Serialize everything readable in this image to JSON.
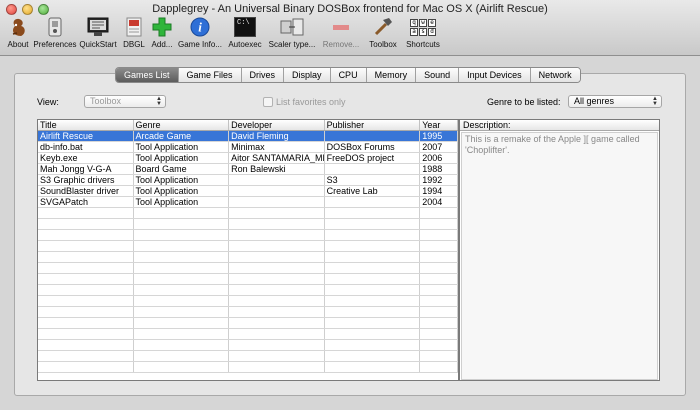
{
  "window": {
    "title": "Dapplegrey - An Universal Binary DOSBox frontend for Mac OS X (Airlift Rescue)"
  },
  "toolbar": [
    {
      "label": "About",
      "icon": "squirrel-icon",
      "enabled": true
    },
    {
      "label": "Preferences",
      "icon": "preferences-icon",
      "enabled": true
    },
    {
      "label": "QuickStart",
      "icon": "monitor-icon",
      "enabled": true
    },
    {
      "label": "DBGL",
      "icon": "dbgl-icon",
      "enabled": true
    },
    {
      "label": "Add...",
      "icon": "add-icon",
      "enabled": true
    },
    {
      "label": "Game Info...",
      "icon": "info-icon",
      "enabled": true
    },
    {
      "label": "Autoexec",
      "icon": "terminal-icon",
      "enabled": true
    },
    {
      "label": "Scaler type...",
      "icon": "scaler-icon",
      "enabled": true
    },
    {
      "label": "Remove...",
      "icon": "remove-icon",
      "enabled": false
    },
    {
      "label": "Toolbox",
      "icon": "hammer-icon",
      "enabled": true
    },
    {
      "label": "Shortcuts",
      "icon": "keyboard-icon",
      "enabled": true
    }
  ],
  "shortcut_keys": [
    "q",
    "w",
    "e",
    "a",
    "s",
    "d"
  ],
  "terminal_glyph": "C:\\",
  "tabs": [
    {
      "label": "Games List",
      "active": true
    },
    {
      "label": "Game Files",
      "active": false
    },
    {
      "label": "Drives",
      "active": false
    },
    {
      "label": "Display",
      "active": false
    },
    {
      "label": "CPU",
      "active": false
    },
    {
      "label": "Memory",
      "active": false
    },
    {
      "label": "Sound",
      "active": false
    },
    {
      "label": "Input Devices",
      "active": false
    },
    {
      "label": "Network",
      "active": false
    }
  ],
  "filters": {
    "view_label": "View:",
    "view_value": "Toolbox",
    "favorites_label": "List favorites only",
    "genre_label": "Genre to be listed:",
    "genre_value": "All genres"
  },
  "table": {
    "columns": [
      "Title",
      "Genre",
      "Developer",
      "Publisher",
      "Year"
    ],
    "rows": [
      {
        "title": "Airlift Rescue",
        "genre": "Arcade Game",
        "developer": "David Fleming",
        "publisher": "",
        "year": "1995",
        "selected": true
      },
      {
        "title": "db-info.bat",
        "genre": "Tool Application",
        "developer": "Minimax",
        "publisher": "DOSBox Forums",
        "year": "2007",
        "selected": false
      },
      {
        "title": "Keyb.exe",
        "genre": "Tool Application",
        "developer": "Aitor SANTAMARIA_MERI...",
        "publisher": "FreeDOS project",
        "year": "2006",
        "selected": false
      },
      {
        "title": "Mah Jongg V-G-A",
        "genre": "Board Game",
        "developer": "Ron Balewski",
        "publisher": "",
        "year": "1988",
        "selected": false
      },
      {
        "title": "S3 Graphic drivers",
        "genre": "Tool Application",
        "developer": "",
        "publisher": "S3",
        "year": "1992",
        "selected": false
      },
      {
        "title": "SoundBlaster driver",
        "genre": "Tool Application",
        "developer": "",
        "publisher": "Creative Lab",
        "year": "1994",
        "selected": false
      },
      {
        "title": "SVGAPatch",
        "genre": "Tool Application",
        "developer": "",
        "publisher": "",
        "year": "2004",
        "selected": false
      }
    ]
  },
  "description": {
    "header": "Description:",
    "text": "This is a remake of the Apple ][ game called 'Choplifter'."
  },
  "colors": {
    "selection": "#3875d7",
    "active_tab": "#6e6e6e"
  }
}
